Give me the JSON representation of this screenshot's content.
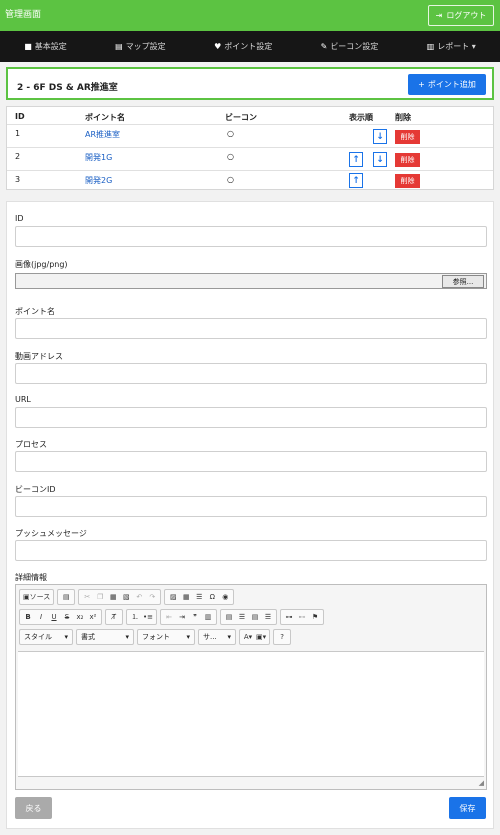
{
  "header": {
    "brand": "管理画面",
    "logout_label": "ログアウト"
  },
  "nav": [
    {
      "icon": "■",
      "label": "基本設定"
    },
    {
      "icon": "▤",
      "label": "マップ設定"
    },
    {
      "icon": "♥",
      "label": "ポイント設定"
    },
    {
      "icon": "✎",
      "label": "ビーコン設定"
    },
    {
      "icon": "▥",
      "label": "レポート ▾"
    }
  ],
  "panel": {
    "title": "2 - 6F DS & AR推進室",
    "add_label": "ポイント追加"
  },
  "table": {
    "headers": {
      "id": "ID",
      "name": "ポイント名",
      "beacon": "ビーコン",
      "order": "表示順",
      "delete": "削除"
    },
    "rows": [
      {
        "id": "1",
        "name": "AR推進室",
        "beacon": "○",
        "delete": "削除"
      },
      {
        "id": "2",
        "name": "開発1G",
        "beacon": "○",
        "delete": "削除"
      },
      {
        "id": "3",
        "name": "開発2G",
        "beacon": "○",
        "delete": "削除"
      }
    ]
  },
  "form": {
    "id_label": "ID",
    "image_label": "画像(jpg/png)",
    "browse_label": "参照...",
    "name_label": "ポイント名",
    "video_label": "動画アドレス",
    "url_label": "URL",
    "process_label": "プロセス",
    "beacon_label": "ビーコンID",
    "push_label": "プッシュメッセージ",
    "detail_label": "詳細情報",
    "back_label": "戻る",
    "save_label": "保存"
  },
  "editor": {
    "source_label": "ソース",
    "style_label": "スタイル",
    "format_label": "書式",
    "font_label": "フォント",
    "size_label": "サ..."
  }
}
